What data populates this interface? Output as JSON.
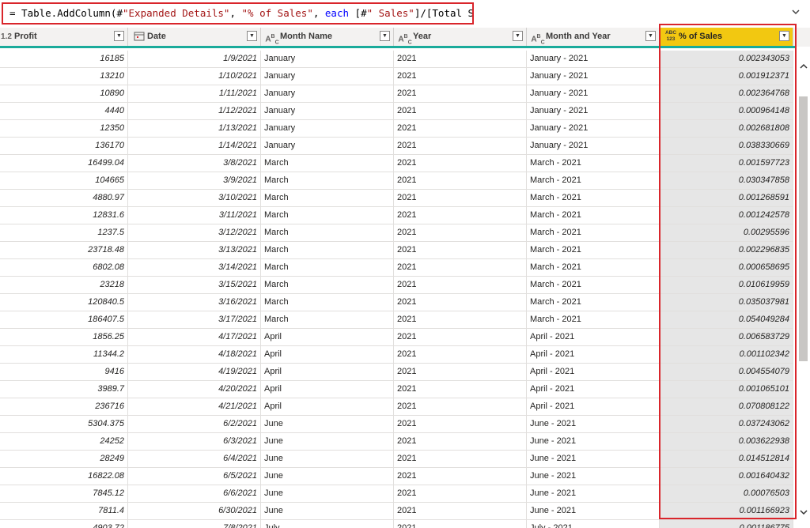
{
  "formula": {
    "prefix": "= Table.AddColumn(#",
    "arg1": "\"Expanded Details\"",
    "comma1": ", ",
    "arg2": "\"% of Sales\"",
    "comma2": ", ",
    "kw": "each",
    "expr_a": " [#",
    "arg3": "\" Sales\"",
    "expr_b": "]/[Total Sales])",
    "expand_icon": "chevron-down-icon"
  },
  "columns": [
    {
      "type_icon": "1.2",
      "label": "Profit"
    },
    {
      "type_icon": "calendar",
      "label": "Date"
    },
    {
      "type_icon": "ABC",
      "label": "Month Name"
    },
    {
      "type_icon": "ABC",
      "label": "Year"
    },
    {
      "type_icon": "ABC",
      "label": "Month and Year"
    },
    {
      "type_icon": "ABC 123",
      "label": "% of Sales"
    }
  ],
  "rows": [
    [
      "16185",
      "1/9/2021",
      "January",
      "2021",
      "January - 2021",
      "0.002343053"
    ],
    [
      "13210",
      "1/10/2021",
      "January",
      "2021",
      "January - 2021",
      "0.001912371"
    ],
    [
      "10890",
      "1/11/2021",
      "January",
      "2021",
      "January - 2021",
      "0.002364768"
    ],
    [
      "4440",
      "1/12/2021",
      "January",
      "2021",
      "January - 2021",
      "0.000964148"
    ],
    [
      "12350",
      "1/13/2021",
      "January",
      "2021",
      "January - 2021",
      "0.002681808"
    ],
    [
      "136170",
      "1/14/2021",
      "January",
      "2021",
      "January - 2021",
      "0.038330669"
    ],
    [
      "16499.04",
      "3/8/2021",
      "March",
      "2021",
      "March - 2021",
      "0.001597723"
    ],
    [
      "104665",
      "3/9/2021",
      "March",
      "2021",
      "March - 2021",
      "0.030347858"
    ],
    [
      "4880.97",
      "3/10/2021",
      "March",
      "2021",
      "March - 2021",
      "0.001268591"
    ],
    [
      "12831.6",
      "3/11/2021",
      "March",
      "2021",
      "March - 2021",
      "0.001242578"
    ],
    [
      "1237.5",
      "3/12/2021",
      "March",
      "2021",
      "March - 2021",
      "0.00295596"
    ],
    [
      "23718.48",
      "3/13/2021",
      "March",
      "2021",
      "March - 2021",
      "0.002296835"
    ],
    [
      "6802.08",
      "3/14/2021",
      "March",
      "2021",
      "March - 2021",
      "0.000658695"
    ],
    [
      "23218",
      "3/15/2021",
      "March",
      "2021",
      "March - 2021",
      "0.010619959"
    ],
    [
      "120840.5",
      "3/16/2021",
      "March",
      "2021",
      "March - 2021",
      "0.035037981"
    ],
    [
      "186407.5",
      "3/17/2021",
      "March",
      "2021",
      "March - 2021",
      "0.054049284"
    ],
    [
      "1856.25",
      "4/17/2021",
      "April",
      "2021",
      "April - 2021",
      "0.006583729"
    ],
    [
      "11344.2",
      "4/18/2021",
      "April",
      "2021",
      "April - 2021",
      "0.001102342"
    ],
    [
      "9416",
      "4/19/2021",
      "April",
      "2021",
      "April - 2021",
      "0.004554079"
    ],
    [
      "3989.7",
      "4/20/2021",
      "April",
      "2021",
      "April - 2021",
      "0.001065101"
    ],
    [
      "236716",
      "4/21/2021",
      "April",
      "2021",
      "April - 2021",
      "0.070808122"
    ],
    [
      "5304.375",
      "6/2/2021",
      "June",
      "2021",
      "June - 2021",
      "0.037243062"
    ],
    [
      "24252",
      "6/3/2021",
      "June",
      "2021",
      "June - 2021",
      "0.003622938"
    ],
    [
      "28249",
      "6/4/2021",
      "June",
      "2021",
      "June - 2021",
      "0.014512814"
    ],
    [
      "16822.08",
      "6/5/2021",
      "June",
      "2021",
      "June - 2021",
      "0.001640432"
    ],
    [
      "7845.12",
      "6/6/2021",
      "June",
      "2021",
      "June - 2021",
      "0.00076503"
    ],
    [
      "7811.4",
      "6/30/2021",
      "June",
      "2021",
      "June - 2021",
      "0.001166923"
    ],
    [
      "4903.72",
      "7/8/2021",
      "July",
      "2021",
      "July - 2021",
      "0.001186775"
    ]
  ],
  "scrollbar": {
    "up_icon": "chevron-up-icon",
    "down_icon": "chevron-down-icon"
  }
}
